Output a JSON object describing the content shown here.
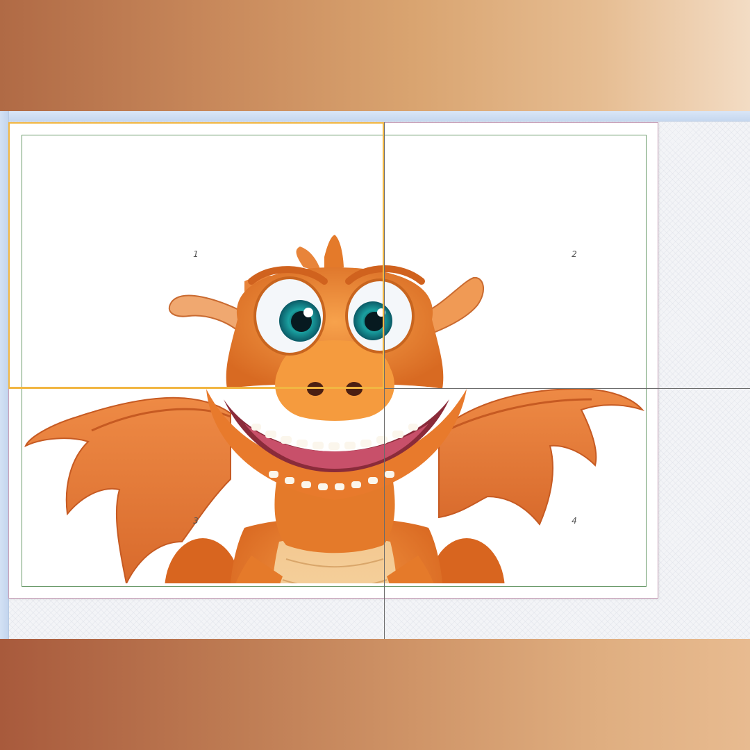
{
  "poster_pages": {
    "page_1_label": "1",
    "page_2_label": "2",
    "page_3_label": "3",
    "page_4_label": "4"
  },
  "image": {
    "subject_icon": "dragon-illustration"
  },
  "colors": {
    "frame_gradient_start": "#b06a45",
    "frame_gradient_end": "#f3dcc4",
    "selection_outline": "#f1b642",
    "margin_guide": "#6a9a6a",
    "split_guide": "#6b6b6b",
    "page_border": "#c8a0b8",
    "dragon_orange": "#f08a30",
    "dragon_belly": "#f6d29a",
    "eye_teal": "#1f9a9a"
  }
}
